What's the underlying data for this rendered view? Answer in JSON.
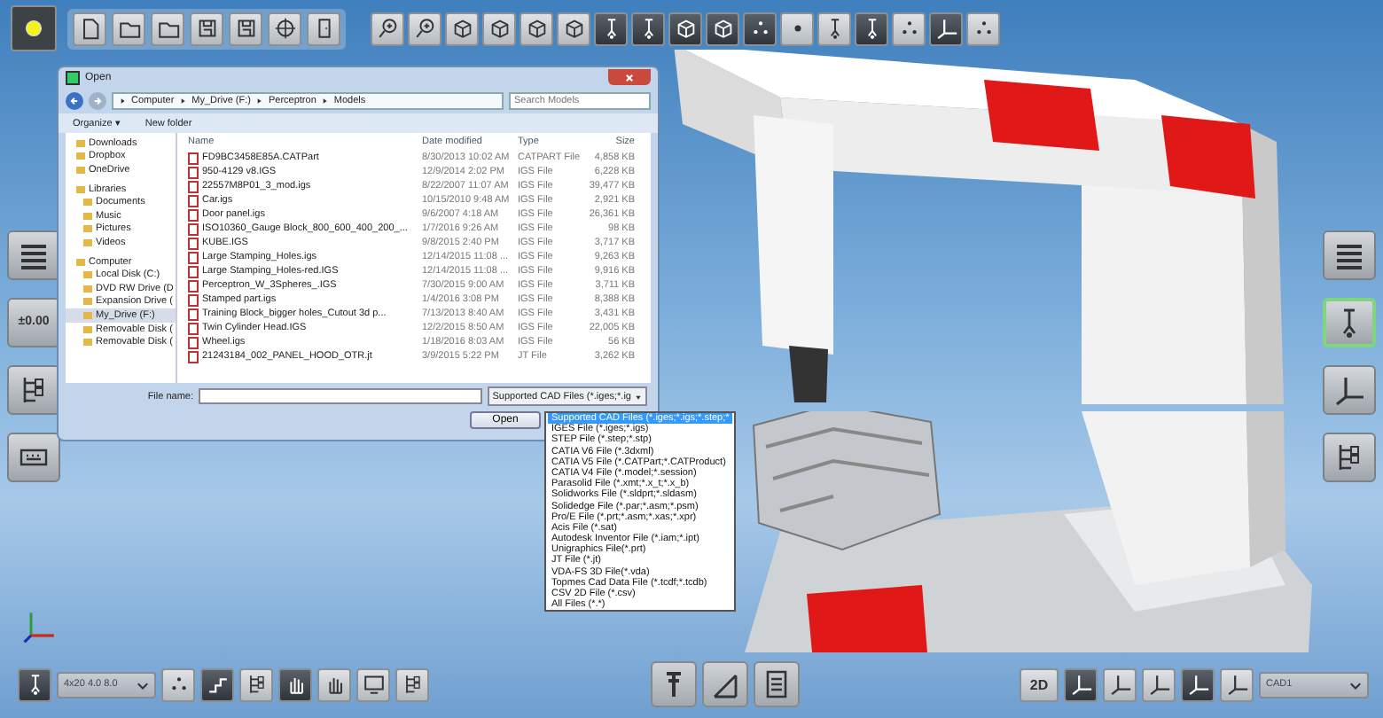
{
  "top_tools": [
    {
      "selected": false
    },
    {
      "selected": false
    },
    {
      "selected": false
    },
    {
      "selected": false
    },
    {
      "selected": false
    },
    {
      "selected": false
    },
    {
      "selected": false
    }
  ],
  "power_button": {
    "on": true
  },
  "view_tools": [
    {
      "selected": false
    },
    {
      "selected": false
    },
    {
      "selected": false
    },
    {
      "selected": false
    },
    {
      "selected": false
    },
    {
      "selected": false
    },
    {
      "selected": true
    },
    {
      "selected": true
    },
    {
      "selected": true
    },
    {
      "selected": true
    },
    {
      "selected": true
    },
    {
      "selected": false
    },
    {
      "selected": false
    },
    {
      "selected": true
    },
    {
      "selected": false
    },
    {
      "selected": true
    },
    {
      "selected": false
    }
  ],
  "left_panel": {
    "display_value": "±0.00"
  },
  "dialog": {
    "title": "Open",
    "path": [
      "Computer",
      "My_Drive (F:)",
      "Perceptron",
      "Models"
    ],
    "search": {
      "placeholder": "Search Models"
    },
    "commands": [
      "Organize ▾",
      "New folder"
    ],
    "sidebar": [
      {
        "label": "Downloads",
        "selected": false
      },
      {
        "label": "Dropbox",
        "selected": false
      },
      {
        "label": "OneDrive",
        "selected": false
      },
      {
        "label": "Libraries",
        "selected": false,
        "children": [
          {
            "label": "Documents",
            "selected": false
          },
          {
            "label": "Music",
            "selected": false
          },
          {
            "label": "Pictures",
            "selected": false
          },
          {
            "label": "Videos",
            "selected": false
          }
        ]
      },
      {
        "label": "Computer",
        "selected": false,
        "children": [
          {
            "label": "Local Disk (C:)",
            "selected": false
          },
          {
            "label": "DVD RW Drive (D",
            "selected": false
          },
          {
            "label": "Expansion Drive (",
            "selected": false
          },
          {
            "label": "My_Drive (F:)",
            "selected": true
          },
          {
            "label": "Removable Disk (",
            "selected": false
          },
          {
            "label": "Removable Disk (",
            "selected": false
          }
        ]
      }
    ],
    "columns": [
      "Name",
      "Date modified",
      "Type",
      "Size"
    ],
    "files": [
      {
        "name": "FD9BC3458E85A.CATPart",
        "date": "8/30/2013 10:02 AM",
        "type": "CATPART File",
        "size": "4,858 KB"
      },
      {
        "name": "950-4129 v8.IGS",
        "date": "12/9/2014 2:02 PM",
        "type": "IGS File",
        "size": "6,228 KB"
      },
      {
        "name": "22557M8P01_3_mod.igs",
        "date": "8/22/2007 11:07 AM",
        "type": "IGS File",
        "size": "39,477 KB"
      },
      {
        "name": "Car.igs",
        "date": "10/15/2010 9:48 AM",
        "type": "IGS File",
        "size": "2,921 KB"
      },
      {
        "name": "Door panel.igs",
        "date": "9/6/2007 4:18 AM",
        "type": "IGS File",
        "size": "26,361 KB"
      },
      {
        "name": "ISO10360_Gauge Block_800_600_400_200_...",
        "date": "1/7/2016 9:26 AM",
        "type": "IGS File",
        "size": "98 KB"
      },
      {
        "name": "KUBE.IGS",
        "date": "9/8/2015 2:40 PM",
        "type": "IGS File",
        "size": "3,717 KB"
      },
      {
        "name": "Large Stamping_Holes.igs",
        "date": "12/14/2015 11:08 ...",
        "type": "IGS File",
        "size": "9,263 KB"
      },
      {
        "name": "Large Stamping_Holes-red.IGS",
        "date": "12/14/2015 11:08 ...",
        "type": "IGS File",
        "size": "9,916 KB"
      },
      {
        "name": "Perceptron_W_3Spheres_.IGS",
        "date": "7/30/2015 9:00 AM",
        "type": "IGS File",
        "size": "3,711 KB"
      },
      {
        "name": "Stamped part.igs",
        "date": "1/4/2016 3:08 PM",
        "type": "IGS File",
        "size": "8,388 KB"
      },
      {
        "name": "Training Block_bigger holes_Cutout 3d p...",
        "date": "7/13/2013 8:40 AM",
        "type": "IGS File",
        "size": "3,431 KB"
      },
      {
        "name": "Twin Cylinder Head.IGS",
        "date": "12/2/2015 8:50 AM",
        "type": "IGS File",
        "size": "22,005 KB"
      },
      {
        "name": "Wheel.igs",
        "date": "1/18/2016 8:03 AM",
        "type": "IGS File",
        "size": "56 KB"
      },
      {
        "name": "21243184_002_PANEL_HOOD_OTR.jt",
        "date": "3/9/2015 5:22 PM",
        "type": "JT File",
        "size": "3,262 KB"
      }
    ],
    "file_name": {
      "label": "File name:"
    },
    "filter": {
      "value": "Supported CAD Files (*.iges;*.ig"
    },
    "open_button": "Open",
    "filter_options": [
      {
        "label": "Supported CAD Files (*.iges;*.igs;*.step;*",
        "selected": true
      },
      {
        "label": "IGES File (*.iges;*.igs)",
        "selected": false
      },
      {
        "label": "STEP File (*.step;*.stp)",
        "selected": false
      },
      {
        "label": "CATIA V6 File (*.3dxml)",
        "selected": false
      },
      {
        "label": "CATIA V5 File (*.CATPart;*.CATProduct)",
        "selected": false
      },
      {
        "label": "CATIA V4 File (*.model;*.session)",
        "selected": false
      },
      {
        "label": "Parasolid File (*.xmt;*.x_t;*.x_b)",
        "selected": false
      },
      {
        "label": "Solidworks File (*.sldprt;*.sldasm)",
        "selected": false
      },
      {
        "label": "Solidedge File (*.par;*.asm;*.psm)",
        "selected": false
      },
      {
        "label": "Pro/E File (*.prt;*.asm;*.xas;*.xpr)",
        "selected": false
      },
      {
        "label": "Acis File (*.sat)",
        "selected": false
      },
      {
        "label": "Autodesk Inventor File (*.iam;*.ipt)",
        "selected": false
      },
      {
        "label": "Unigraphics File(*.prt)",
        "selected": false
      },
      {
        "label": "JT File (*.jt)",
        "selected": false
      },
      {
        "label": "VDA-FS 3D File(*.vda)",
        "selected": false
      },
      {
        "label": "Topmes Cad Data File (*.tcdf;*.tcdb)",
        "selected": false
      },
      {
        "label": "CSV 2D File (*.csv)",
        "selected": false
      },
      {
        "label": "All Files (*.*)",
        "selected": false
      }
    ]
  },
  "bottom_left_tools": [
    {
      "selected": true
    },
    {
      "selected": false
    },
    {
      "selected": true
    },
    {
      "selected": false
    },
    {
      "selected": true
    },
    {
      "selected": false
    },
    {
      "selected": false
    },
    {
      "selected": false
    }
  ],
  "style_select": {
    "value": "4x20 4.0 8.0"
  },
  "view_2d_button": {
    "label": "2D",
    "selected": false
  },
  "bottom_right_tools": [
    {
      "selected": true
    },
    {
      "selected": false
    },
    {
      "selected": false
    },
    {
      "selected": true
    },
    {
      "selected": false
    }
  ],
  "cad_select": {
    "value": "CAD1"
  },
  "right_panel_tools": [
    {
      "selected": false
    },
    {
      "selected": true
    },
    {
      "selected": false
    },
    {
      "selected": false
    }
  ]
}
